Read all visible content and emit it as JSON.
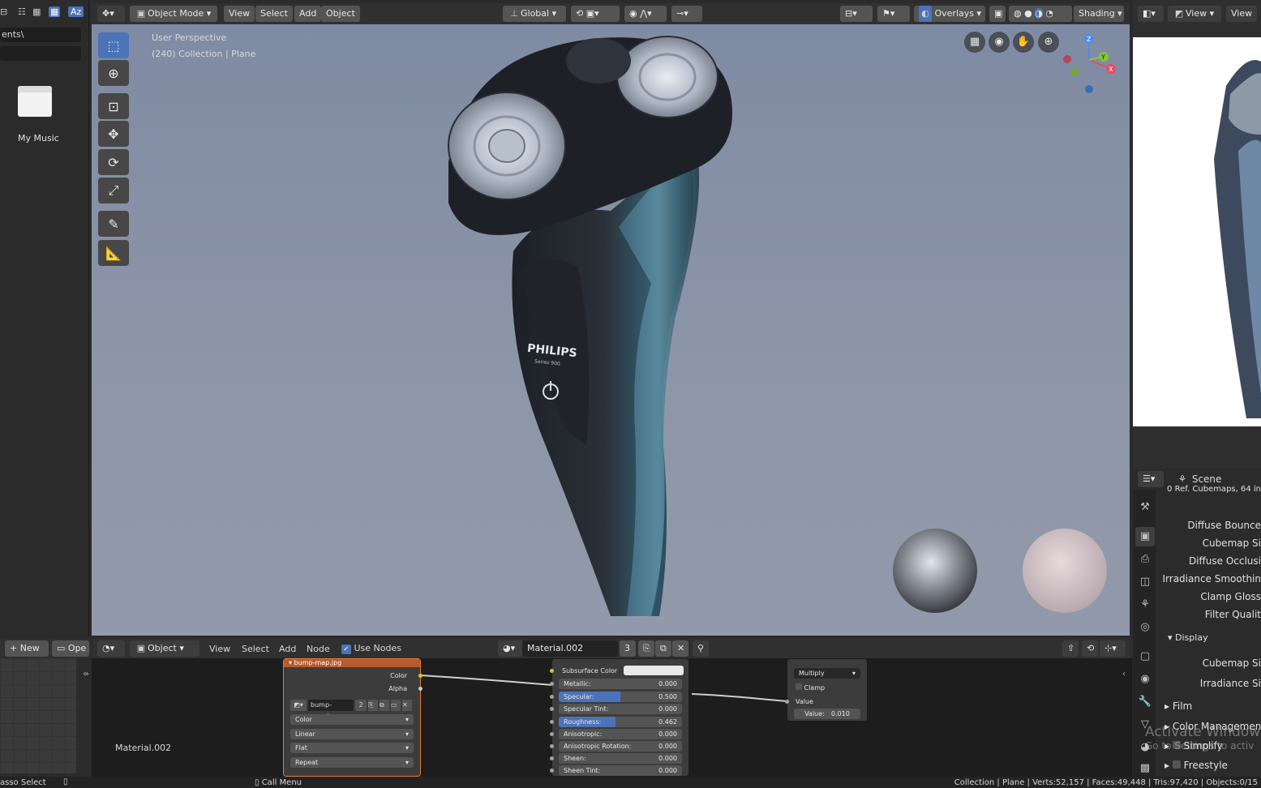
{
  "outliner": {
    "path": "ents\\",
    "folder_label": "My Music"
  },
  "viewport": {
    "mode": "Object Mode",
    "menus": [
      "View",
      "Select",
      "Add",
      "Object"
    ],
    "transform": "Global",
    "overlays": "Overlays",
    "shading": "Shading",
    "info_line1": "User Perspective",
    "info_line2": "(240) Collection | Plane",
    "brand": "PHILIPS",
    "brand_sub": "Series 900"
  },
  "right_header": {
    "view": "View",
    "view2": "View"
  },
  "properties": {
    "scene": "Scene",
    "cut_line": "0 Ref. Cubemaps, 64 in",
    "items": [
      "Diffuse Bounce",
      "Cubemap Si",
      "Diffuse Occlusi",
      "Irradiance Smoothin",
      "Clamp Gloss",
      "Filter Qualit"
    ],
    "display": "Display",
    "display_items": [
      "Cubemap Si",
      "Irradiance Si"
    ],
    "sections": [
      "Film",
      "Color Management",
      "Simplify",
      "Freestyle"
    ]
  },
  "watermark": {
    "line1": "Activate Window",
    "line2": "Go to Settings to activ"
  },
  "image_editor": {
    "new": "New",
    "open": "Ope",
    "image_name": "Material.002"
  },
  "node_editor": {
    "object": "Object",
    "menus": [
      "View",
      "Select",
      "Add",
      "Node"
    ],
    "use_nodes": "Use Nodes",
    "material": "Material.002",
    "users": "3"
  },
  "image_node": {
    "title": "bump-map.jpg",
    "out_color": "Color",
    "out_alpha": "Alpha",
    "file": "bump-map.j..",
    "users": "2",
    "color_space": "Color",
    "interpolation": "Linear",
    "projection": "Flat",
    "extension": "Repeat"
  },
  "bsdf_node": {
    "subsurface_color": "Subsurface Color",
    "rows": [
      {
        "label": "Metallic:",
        "value": "0.000",
        "fill": 0
      },
      {
        "label": "Specular:",
        "value": "0.500",
        "fill": 0.5
      },
      {
        "label": "Specular Tint:",
        "value": "0.000",
        "fill": 0
      },
      {
        "label": "Roughness:",
        "value": "0.462",
        "fill": 0.462
      },
      {
        "label": "Anisotropic:",
        "value": "0.000",
        "fill": 0
      },
      {
        "label": "Anisotropic Rotation:",
        "value": "0.000",
        "fill": 0
      },
      {
        "label": "Sheen:",
        "value": "0.000",
        "fill": 0
      },
      {
        "label": "Sheen Tint:",
        "value": "0.000",
        "fill": 0
      }
    ]
  },
  "math_node": {
    "operation": "Multiply",
    "clamp": "Clamp",
    "value_label": "Value",
    "value": "Value:",
    "value_num": "0.010"
  },
  "status": {
    "left": "asso Select",
    "middle": "Call Menu",
    "right": "Collection | Plane | Verts:52,157 | Faces:49,448 | Tris:97,420 | Objects:0/15"
  },
  "colors": {
    "accent": "#4b73b8",
    "node_header_orange": "#e07c3a",
    "viewport_bg": "#8690a6"
  }
}
